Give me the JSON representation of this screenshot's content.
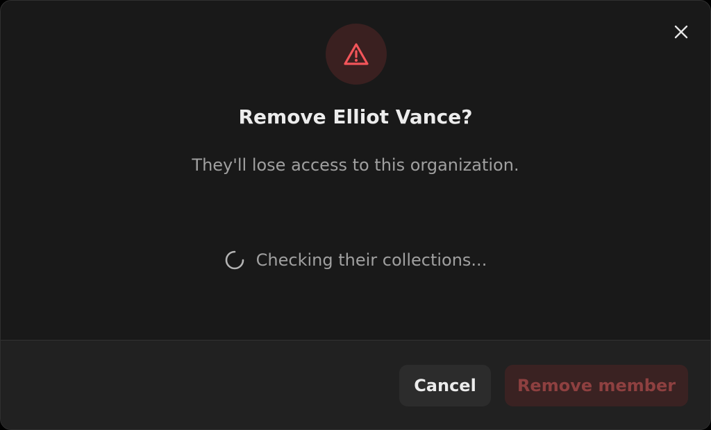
{
  "dialog": {
    "title": "Remove Elliot Vance?",
    "subtitle": "They'll lose access to this organization.",
    "loading_text": "Checking their collections...",
    "close_icon": "close-icon",
    "warning_icon": "warning-triangle-icon",
    "spinner_icon": "loading-spinner-icon"
  },
  "footer": {
    "cancel_label": "Cancel",
    "remove_label": "Remove member",
    "remove_state": "disabled"
  },
  "colors": {
    "background": "#191919",
    "footer_background": "#212121",
    "danger": "#e5484d",
    "danger_muted": "#8e4040",
    "text_primary": "#ececec",
    "text_secondary": "#a0a0a0"
  }
}
